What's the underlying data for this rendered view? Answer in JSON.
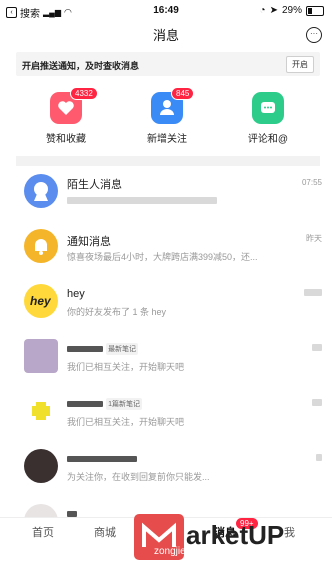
{
  "status_bar": {
    "back_label": "搜索",
    "time": "16:49",
    "battery": "29%",
    "battery_level": 0.29
  },
  "header": {
    "title": "消息"
  },
  "notify": {
    "text": "开启推送通知，及时查收消息",
    "button": "开启"
  },
  "quick_actions": [
    {
      "label": "赞和收藏",
      "badge": "4332",
      "icon": "heart-icon",
      "color": "#ff5a6e"
    },
    {
      "label": "新增关注",
      "badge": "845",
      "icon": "person-icon",
      "color": "#3b8bf6"
    },
    {
      "label": "评论和@",
      "badge": "",
      "icon": "comment-icon",
      "color": "#2dcc8a"
    }
  ],
  "messages": [
    {
      "title": "陌生人消息",
      "subtitle": "",
      "time": "07:55"
    },
    {
      "title": "通知消息",
      "subtitle": "惊喜夜场最后4小时，大牌跨店满399减50，还...",
      "time": "昨天"
    },
    {
      "title": "hey",
      "subtitle": "你的好友发布了 1 条 hey",
      "time": ""
    },
    {
      "title": "",
      "tag": "最新笔记",
      "subtitle": "我们已相互关注，开始聊天吧",
      "time": ""
    },
    {
      "title": "",
      "tag": "1篇新笔记",
      "subtitle": "我们已相互关注，开始聊天吧",
      "time": ""
    },
    {
      "title": "",
      "subtitle": "为关注你，在收到回复前你只能发...",
      "time": ""
    }
  ],
  "tabbar": {
    "home": "首页",
    "mall": "商城",
    "messages": "消息",
    "me": "我",
    "message_badge": "99+"
  },
  "watermark": {
    "text": "arketUP",
    "sub": "zongjieshangXuejuntu"
  }
}
